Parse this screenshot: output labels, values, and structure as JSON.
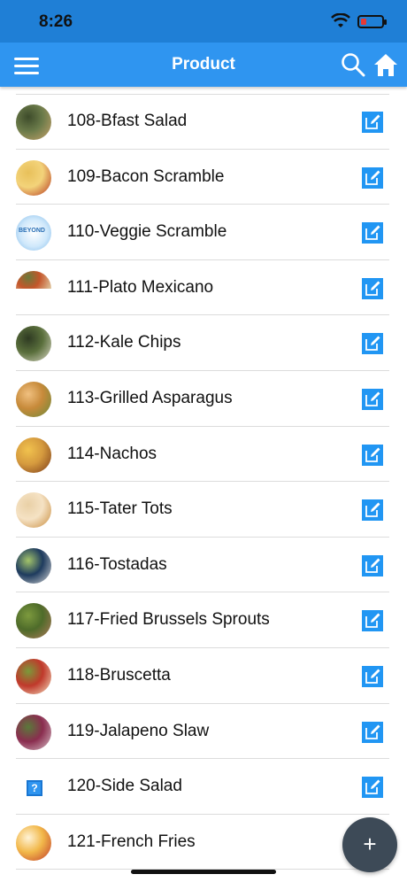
{
  "status_bar": {
    "time": "8:26"
  },
  "header": {
    "title": "Product"
  },
  "products": [
    {
      "label": "108-Bfast Salad",
      "thumb": "img",
      "colors": [
        "#6b7b4a",
        "#c9a36b",
        "#3d4b2a"
      ]
    },
    {
      "label": "109-Bacon Scramble",
      "thumb": "img",
      "colors": [
        "#f3d37a",
        "#b5351f",
        "#e8c05a"
      ]
    },
    {
      "label": "110-Veggie Scramble",
      "thumb": "brand",
      "colors": [
        "#cfe8fb",
        "#7fb8e8",
        "#ffffff"
      ]
    },
    {
      "label": "111-Plato Mexicano",
      "thumb": "cut",
      "colors": [
        "#c4562b",
        "#e0c9a0",
        "#6a7a3a"
      ]
    },
    {
      "label": "112-Kale Chips",
      "thumb": "img",
      "colors": [
        "#5a6f3c",
        "#dcd9c8",
        "#2e3a22"
      ]
    },
    {
      "label": "113-Grilled Asparagus",
      "thumb": "img",
      "colors": [
        "#c78a3a",
        "#6b8a3a",
        "#f0c080"
      ]
    },
    {
      "label": "114-Nachos",
      "thumb": "img",
      "colors": [
        "#d59a3e",
        "#7a3a18",
        "#f1c24e"
      ]
    },
    {
      "label": "115-Tater Tots",
      "thumb": "img",
      "colors": [
        "#f5e2c4",
        "#c78a3a",
        "#e9d0a6"
      ]
    },
    {
      "label": "116-Tostadas",
      "thumb": "img",
      "colors": [
        "#1e3b5e",
        "#d9d9d9",
        "#a3c46a"
      ]
    },
    {
      "label": "117-Fried Brussels Sprouts",
      "thumb": "img",
      "colors": [
        "#4e6b2a",
        "#b07a5a",
        "#7d9a3e"
      ]
    },
    {
      "label": "118-Bruscetta",
      "thumb": "img",
      "colors": [
        "#c0392b",
        "#f4e2c2",
        "#7a9a3a"
      ]
    },
    {
      "label": "119-Jalapeno Slaw",
      "thumb": "img",
      "colors": [
        "#8a2d4f",
        "#d7c0c8",
        "#5a7a3a"
      ]
    },
    {
      "label": "120-Side Salad",
      "thumb": "placeholder",
      "placeholder_text": "?",
      "colors": [
        "#2f95f0"
      ]
    },
    {
      "label": "121-French Fries",
      "thumb": "img",
      "colors": [
        "#f2b84a",
        "#c0392b",
        "#fff3d6"
      ]
    }
  ],
  "brand_thumb_text": "BEYOND",
  "fab": {
    "label": "+"
  },
  "icons": {
    "menu": "menu-icon",
    "search": "search-icon",
    "home": "home-icon",
    "edit": "edit-icon",
    "add": "add-icon"
  },
  "theme": {
    "status_bar": "#1f7fd6",
    "nav_bar": "#2f95f0",
    "accent": "#2196f3",
    "fab": "#3d4a57"
  }
}
